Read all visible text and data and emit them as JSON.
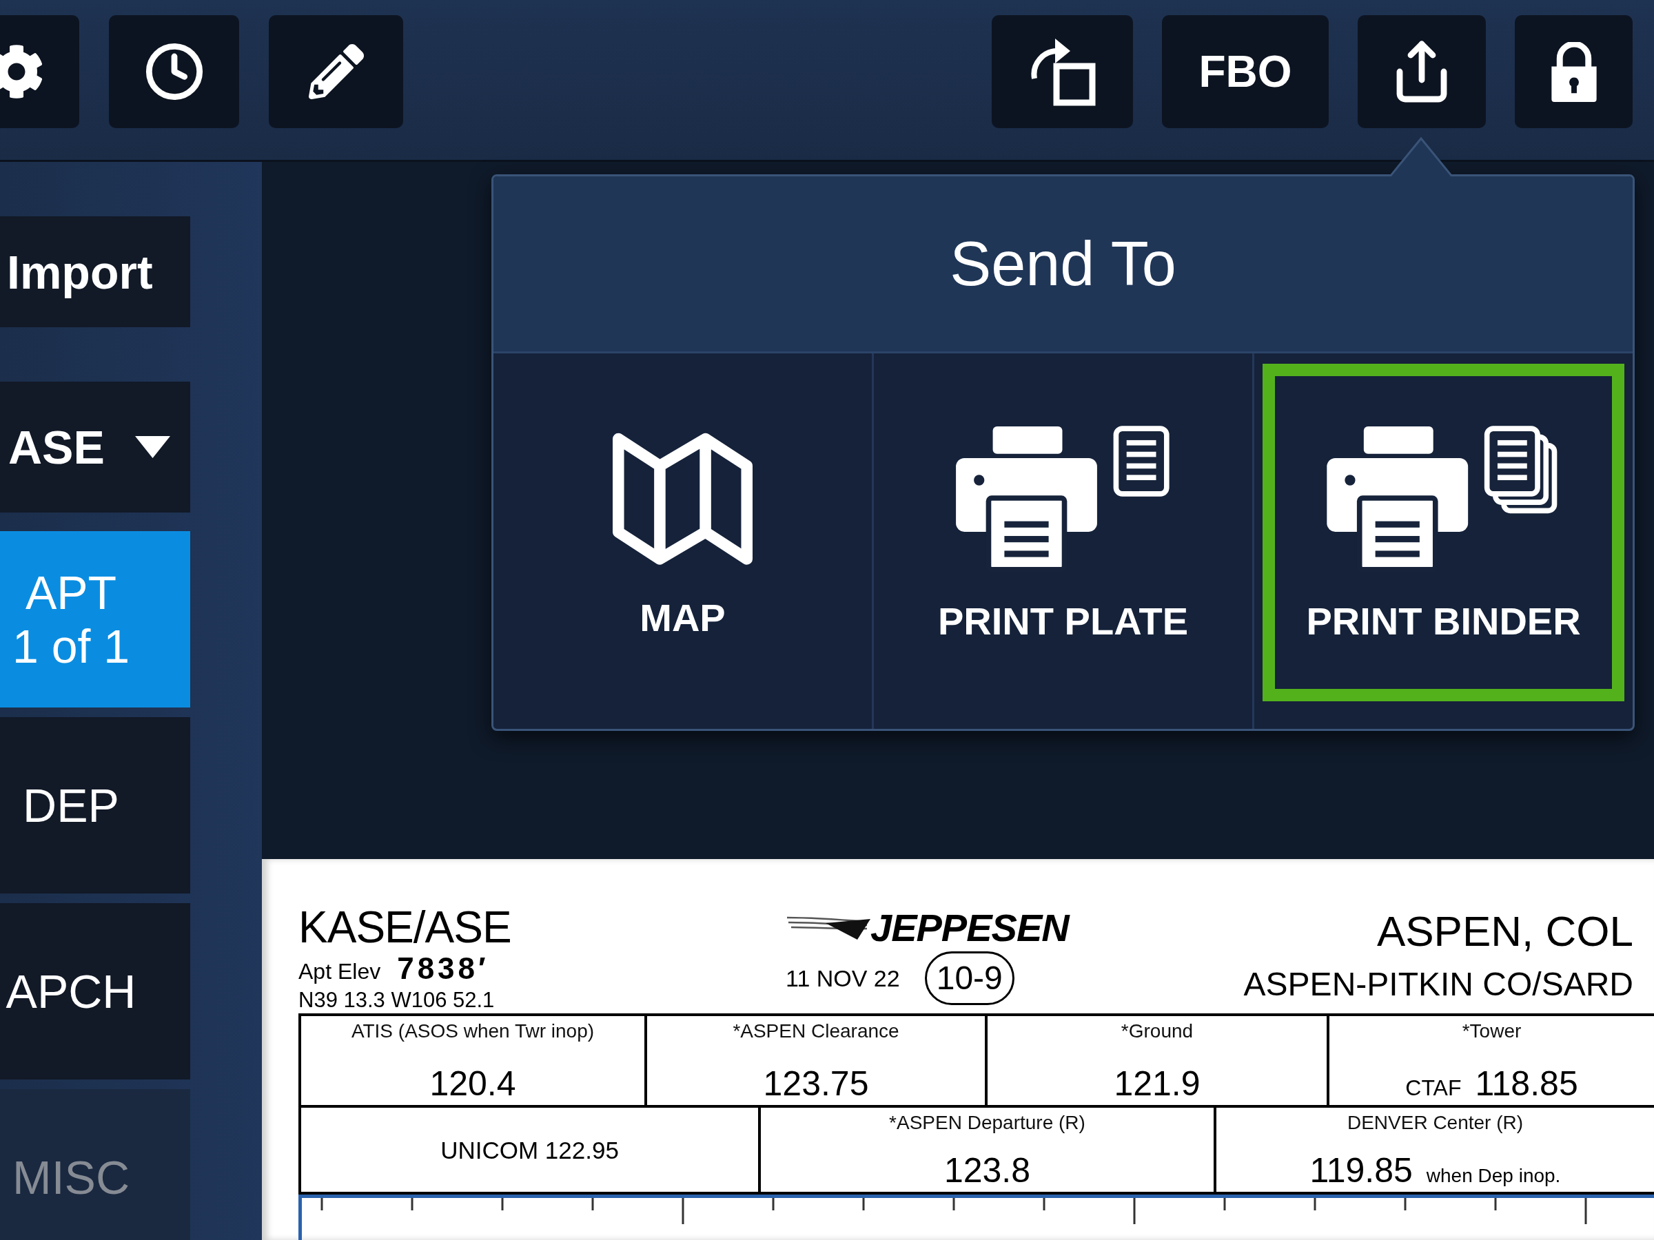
{
  "toolbar": {
    "text_button": "FBO"
  },
  "sidebar": {
    "import_button": "Import",
    "airport_selector": "ASE",
    "items": [
      {
        "label": "APT",
        "sublabel": "1 of 1",
        "selected": true,
        "disabled": false
      },
      {
        "label": "DEP",
        "selected": false,
        "disabled": false
      },
      {
        "label": "APCH",
        "selected": false,
        "disabled": false
      },
      {
        "label": "MISC",
        "selected": false,
        "disabled": true
      }
    ]
  },
  "popover": {
    "title": "Send To",
    "options": [
      {
        "label": "MAP",
        "highlighted": false
      },
      {
        "label": "PRINT PLATE",
        "highlighted": false
      },
      {
        "label": "PRINT BINDER",
        "highlighted": true
      }
    ]
  },
  "chart": {
    "airport_ident": "KASE/ASE",
    "elevation_label": "Apt Elev",
    "elevation": "7838′",
    "coordinates": "N39 13.3 W106 52.1",
    "publisher": "JEPPESEN",
    "date": "11 NOV 22",
    "chart_number": "10-9",
    "city": "ASPEN, COL",
    "airport_name": "ASPEN-PITKIN CO/SARD",
    "frequency_rows": [
      [
        {
          "kind": "frequency",
          "label": "ATIS (ASOS when Twr inop)",
          "value": "120.4"
        },
        {
          "kind": "frequency",
          "label": "*ASPEN Clearance",
          "value": "123.75"
        },
        {
          "kind": "frequency",
          "label": "*Ground",
          "value": "121.9"
        },
        {
          "kind": "frequency",
          "label": "*Tower",
          "prefix": "CTAF",
          "value": "118.85"
        }
      ],
      [
        {
          "kind": "note",
          "label": "UNICOM 122.95"
        },
        {
          "kind": "frequency",
          "label": "*ASPEN Departure (R)",
          "value": "123.8"
        },
        {
          "kind": "frequency",
          "label": "DENVER Center (R)",
          "value": "119.85",
          "suffix": "when Dep inop."
        }
      ]
    ]
  }
}
